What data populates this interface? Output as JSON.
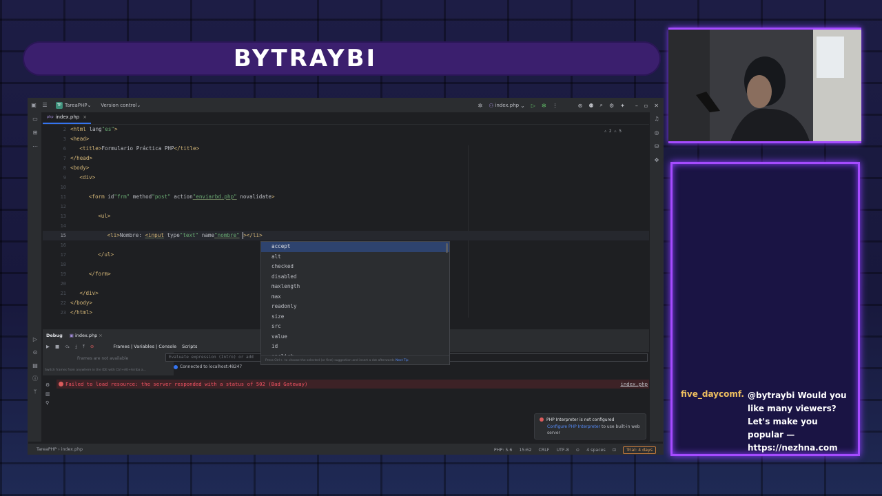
{
  "banner": {
    "title": "BYTRAYBI"
  },
  "ide": {
    "project_badge": "TP",
    "project_name": "TareaPHP",
    "vcs_label": "Version control",
    "run_config": "index.php",
    "tab": {
      "label": "index.php",
      "lang": "php"
    },
    "gutter_indicators": "⚠ 2  ⚠ 5",
    "code_lines": [
      {
        "n": "2",
        "text": "<html lang=\"es\">"
      },
      {
        "n": "3",
        "text": "<head>"
      },
      {
        "n": "6",
        "text": "<title>Formulario Práctica PHP</title>"
      },
      {
        "n": "7",
        "text": "</head>"
      },
      {
        "n": "8",
        "text": "<body>"
      },
      {
        "n": "9",
        "text": "<div>"
      },
      {
        "n": "10",
        "text": ""
      },
      {
        "n": "11",
        "text": "<form id=\"frm\" method=\"post\" action=\"enviarbd.php\" novalidate>"
      },
      {
        "n": "12",
        "text": ""
      },
      {
        "n": "13",
        "text": "<ul>"
      },
      {
        "n": "14",
        "text": ""
      },
      {
        "n": "15",
        "text": "<li>Nombre: <input type=\"text\" name=\"nombre\" ></li>"
      },
      {
        "n": "16",
        "text": ""
      },
      {
        "n": "17",
        "text": "</ul>"
      },
      {
        "n": "18",
        "text": ""
      },
      {
        "n": "19",
        "text": "</form>"
      },
      {
        "n": "20",
        "text": ""
      },
      {
        "n": "21",
        "text": "</div>"
      },
      {
        "n": "22",
        "text": "</body>"
      },
      {
        "n": "23",
        "text": "</html>"
      }
    ],
    "autocomplete": {
      "items": [
        "accept",
        "alt",
        "checked",
        "disabled",
        "maxlength",
        "max",
        "readonly",
        "size",
        "src",
        "value",
        "id",
        "onclick"
      ],
      "footer": "Press Ctrl+. to choose the selected (or first) suggestion and insert a dot afterwards",
      "footer_link": "Next Tip"
    },
    "debug": {
      "title": "Debug",
      "session_tab": "index.php",
      "frames_tab": "Frames | Variables | Console",
      "scripts_tab": "Scripts",
      "frames_empty": "Frames are not available",
      "switch_hint": "Switch frames from anywhere in the IDE with Ctrl+Alt+Arriba a...",
      "eval_placeholder": "Evaluate expression (Intro) or add",
      "connected": "Connected to localhost:48247",
      "error_text": "Failed to load resource: the server responded with a status of 502 (Bad Gateway)",
      "error_link": "index.php"
    },
    "notification": {
      "title": "PHP Interpreter is not configured",
      "link": "Configure PHP Interpreter",
      "rest": " to use built-in web server"
    },
    "statusbar": {
      "breadcrumb_project": "TareaPHP",
      "breadcrumb_file": "index.php",
      "php_version": "PHP: 5.6",
      "position": "15:62",
      "line_sep": "CRLF",
      "encoding": "UTF-8",
      "indent": "4 spaces",
      "trial": "Trial: 4 days"
    }
  },
  "chat": {
    "user": "five_daycomf...",
    "message": "@bytraybi Would you like many viewers? Let's make you popular — https://nezhna.com"
  },
  "colors": {
    "accent_purple": "#a64bff",
    "error_red": "#f75464",
    "link_blue": "#548af7"
  }
}
